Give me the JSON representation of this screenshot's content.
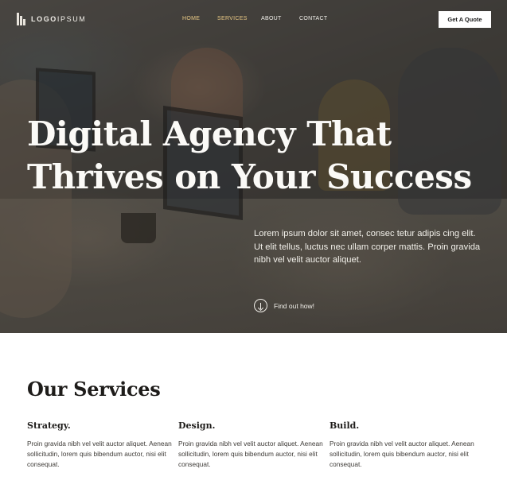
{
  "brand": {
    "name_left": "LOGO",
    "name_right": "IPSUM"
  },
  "nav": {
    "items": [
      {
        "label": "HOME",
        "active": true
      },
      {
        "label": "SERVICES",
        "active": true
      },
      {
        "label": "ABOUT",
        "active": false
      },
      {
        "label": "CONTACT",
        "active": false
      }
    ],
    "cta_label": "Get A Quote"
  },
  "hero": {
    "title_line1": "Digital Agency That",
    "title_line2": "Thrives on Your Success",
    "description": "Lorem ipsum dolor sit amet, consec tetur adipis cing elit. Ut elit tellus, luctus nec ullam corper mattis. Proin gravida nibh vel velit auctor aliquet.",
    "link_label": "Find out how!",
    "link_icon": "arrow-down-circle-icon"
  },
  "services": {
    "title": "Our Services",
    "items": [
      {
        "name": "Strategy.",
        "text": "Proin gravida nibh vel velit auctor aliquet. Aenean sollicitudin, lorem quis bibendum auctor, nisi elit consequat."
      },
      {
        "name": "Design.",
        "text": "Proin gravida nibh vel velit auctor aliquet. Aenean sollicitudin, lorem quis bibendum auctor, nisi elit consequat."
      },
      {
        "name": "Build.",
        "text": "Proin gravida nibh vel velit auctor aliquet. Aenean sollicitudin, lorem quis bibendum auctor, nisi elit consequat."
      }
    ]
  },
  "colors": {
    "accent": "#e9c985",
    "text_dark": "#1e1c1a",
    "hero_text": "#fbfaf7"
  }
}
